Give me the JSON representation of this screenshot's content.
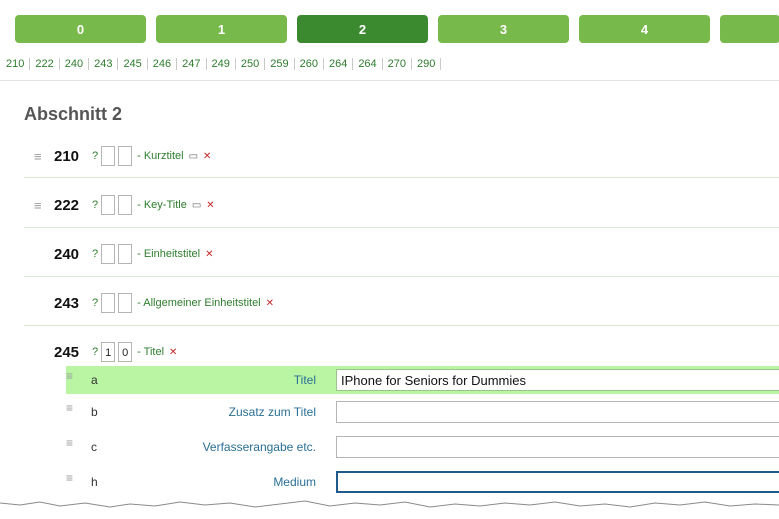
{
  "tabs": [
    "0",
    "1",
    "2",
    "3",
    "4",
    ""
  ],
  "active_tab": "2",
  "field_numbers": [
    "210",
    "222",
    "240",
    "243",
    "245",
    "246",
    "247",
    "249",
    "250",
    "259",
    "260",
    "264",
    "264",
    "270",
    "290"
  ],
  "section_title": "Abschnitt 2",
  "fields": [
    {
      "tag": "210",
      "q": "?",
      "ind1": "",
      "ind2": "",
      "label": "- Kurztitel",
      "icons": [
        "copy-icon",
        "delete-icon"
      ]
    },
    {
      "tag": "222",
      "q": "?",
      "ind1": "",
      "ind2": "",
      "label": "- Key-Title",
      "icons": [
        "copy-icon",
        "delete-icon"
      ]
    },
    {
      "tag": "240",
      "q": "?",
      "ind1": "",
      "ind2": "",
      "label": "- Einheitstitel",
      "icons": [
        "delete-icon"
      ]
    },
    {
      "tag": "243",
      "q": "?",
      "ind1": "",
      "ind2": "",
      "label": "- Allgemeiner Einheitstitel",
      "icons": [
        "delete-icon"
      ]
    },
    {
      "tag": "245",
      "q": "?",
      "ind1": "1",
      "ind2": "0",
      "label": "- Titel",
      "icons": [
        "delete-icon"
      ]
    }
  ],
  "subfields": [
    {
      "code": "a",
      "label": "Titel",
      "value": "IPhone for Seniors for Dummies"
    },
    {
      "code": "b",
      "label": "Zusatz zum Titel",
      "value": ""
    },
    {
      "code": "c",
      "label": "Verfasserangabe etc.",
      "value": ""
    },
    {
      "code": "h",
      "label": "Medium",
      "value": ""
    }
  ],
  "colors": {
    "tab": "#77b94a",
    "tab_active": "#3c8a2f",
    "highlight": "#b9f5a3",
    "link": "#2e7d2e",
    "sublabel": "#2a6f96"
  }
}
